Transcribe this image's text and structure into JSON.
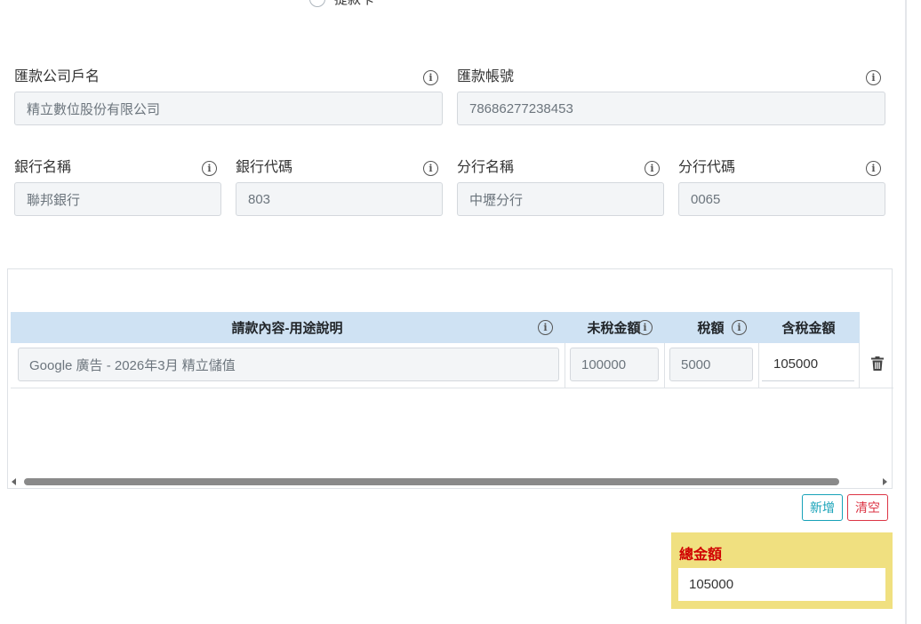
{
  "top_radio": {
    "label": "提款卡"
  },
  "company_name": {
    "label": "匯款公司戶名",
    "value": "精立數位股份有限公司"
  },
  "account_number": {
    "label": "匯款帳號",
    "value": "78686277238453"
  },
  "bank_name": {
    "label": "銀行名稱",
    "value": "聯邦銀行"
  },
  "bank_code": {
    "label": "銀行代碼",
    "value": "803"
  },
  "branch_name": {
    "label": "分行名稱",
    "value": "中壢分行"
  },
  "branch_code": {
    "label": "分行代碼",
    "value": "0065"
  },
  "info_glyph": "i",
  "table": {
    "headers": {
      "description": "請款內容-用途說明",
      "pre_tax": "未稅金額",
      "tax": "稅額",
      "total": "含稅金額"
    },
    "rows": [
      {
        "description": "Google 廣告 - 2026年3月 精立儲值",
        "pre_tax": "100000",
        "tax": "5000",
        "total": "105000"
      }
    ]
  },
  "buttons": {
    "add": "新增",
    "clear": "清空"
  },
  "total": {
    "label": "總金額",
    "value": "105000"
  },
  "colors": {
    "header_bg": "#cfe2f3",
    "total_bg": "#f0e080",
    "total_label": "#d00000",
    "add_button": "#17a2b8",
    "clear_button": "#dc3545"
  },
  "icons": {
    "info": "info-circle-icon",
    "delete": "trash-icon",
    "scroll_left": "caret-left-icon",
    "scroll_right": "caret-right-icon"
  }
}
